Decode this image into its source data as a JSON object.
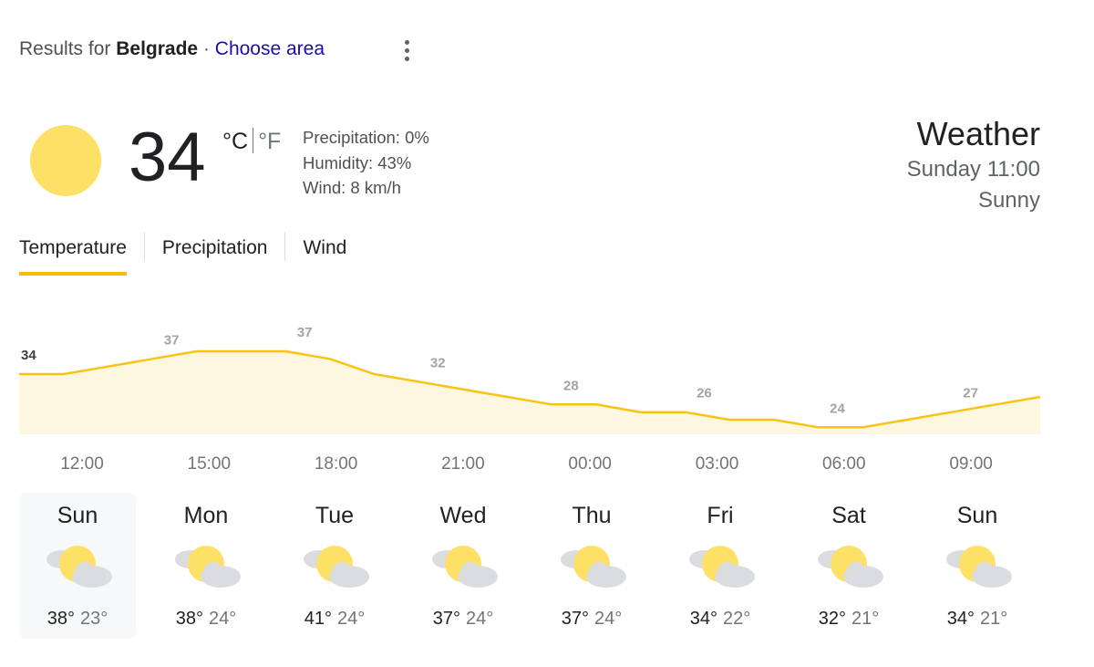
{
  "header": {
    "results_prefix": "Results for",
    "location": "Belgrade",
    "separator": "·",
    "choose_area": "Choose area"
  },
  "current": {
    "icon": "sun-icon",
    "temperature": "34",
    "unit_c": "°C",
    "unit_f": "°F",
    "precipitation": "Precipitation: 0%",
    "humidity": "Humidity: 43%",
    "wind": "Wind: 8 km/h"
  },
  "summary": {
    "title": "Weather",
    "datetime": "Sunday 11:00",
    "condition": "Sunny"
  },
  "tabs": [
    "Temperature",
    "Precipitation",
    "Wind"
  ],
  "active_tab": "Temperature",
  "colors": {
    "accent": "#fbbc04",
    "line": "#f9c313",
    "fill": "#fef7e0",
    "sun": "#fce166",
    "cloud": "#dadce0"
  },
  "chart_data": {
    "type": "area",
    "x": [
      "11:00",
      "12:00",
      "13:00",
      "14:00",
      "15:00",
      "16:00",
      "17:00",
      "18:00",
      "19:00",
      "20:00",
      "21:00",
      "22:00",
      "23:00",
      "00:00",
      "01:00",
      "02:00",
      "03:00",
      "04:00",
      "05:00",
      "06:00",
      "07:00",
      "08:00",
      "09:00",
      "10:00"
    ],
    "values": [
      34,
      34,
      35,
      36,
      37,
      37,
      37,
      36,
      34,
      33,
      32,
      31,
      30,
      30,
      29,
      29,
      28,
      28,
      27,
      27,
      28,
      29,
      30,
      31
    ],
    "labels": [
      {
        "i": 0,
        "text": "34"
      },
      {
        "i": 3,
        "text": "37"
      },
      {
        "i": 6,
        "text": "37"
      },
      {
        "i": 9,
        "text": "32"
      },
      {
        "i": 12,
        "text": "28"
      },
      {
        "i": 15,
        "text": "26"
      },
      {
        "i": 18,
        "text": "24"
      },
      {
        "i": 21,
        "text": "27"
      }
    ],
    "tick_labels": [
      "12:00",
      "15:00",
      "18:00",
      "21:00",
      "00:00",
      "03:00",
      "06:00",
      "09:00"
    ],
    "ylim": [
      22,
      40
    ]
  },
  "days": [
    {
      "name": "Sun",
      "high": "38°",
      "low": "23°",
      "icon": "partly-cloudy-icon",
      "selected": true
    },
    {
      "name": "Mon",
      "high": "38°",
      "low": "24°",
      "icon": "partly-cloudy-icon",
      "selected": false
    },
    {
      "name": "Tue",
      "high": "41°",
      "low": "24°",
      "icon": "partly-cloudy-icon",
      "selected": false
    },
    {
      "name": "Wed",
      "high": "37°",
      "low": "24°",
      "icon": "partly-cloudy-icon",
      "selected": false
    },
    {
      "name": "Thu",
      "high": "37°",
      "low": "24°",
      "icon": "partly-cloudy-icon",
      "selected": false
    },
    {
      "name": "Fri",
      "high": "34°",
      "low": "22°",
      "icon": "partly-cloudy-icon",
      "selected": false
    },
    {
      "name": "Sat",
      "high": "32°",
      "low": "21°",
      "icon": "partly-cloudy-icon",
      "selected": false
    },
    {
      "name": "Sun",
      "high": "34°",
      "low": "21°",
      "icon": "partly-cloudy-icon",
      "selected": false
    }
  ]
}
